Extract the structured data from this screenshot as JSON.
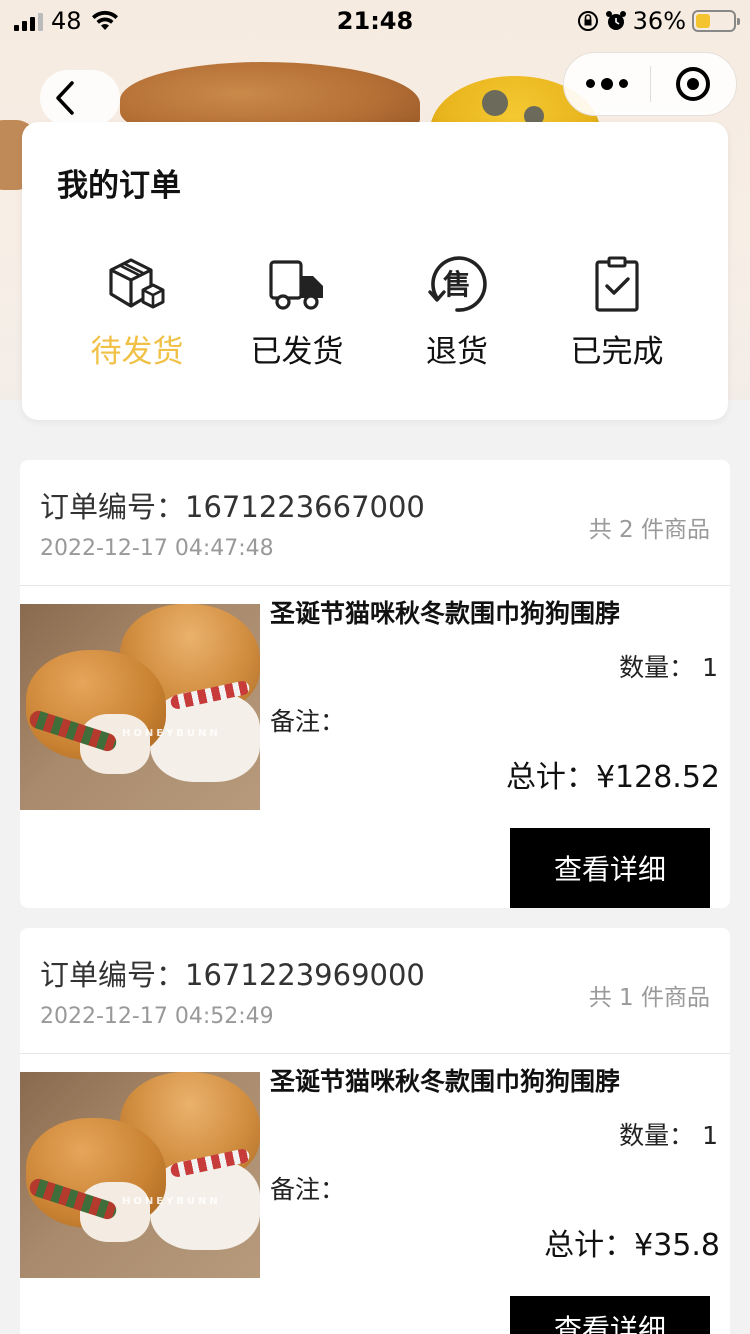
{
  "status_bar": {
    "signal_text": "48",
    "time": "21:48",
    "battery_text": "36%"
  },
  "my_orders": {
    "title": "我的订单",
    "tabs": [
      {
        "label": "待发货",
        "icon": "package-icon",
        "active": true
      },
      {
        "label": "已发货",
        "icon": "truck-icon",
        "active": false
      },
      {
        "label": "退货",
        "icon": "return-icon",
        "active": false
      },
      {
        "label": "已完成",
        "icon": "clipboard-check-icon",
        "active": false
      }
    ]
  },
  "orders": [
    {
      "number_label": "订单编号：",
      "number": "1671223667000",
      "date": "2022-12-17 04:47:48",
      "count_text": "共 2 件商品",
      "product_title": "圣诞节猫咪秋冬款围巾狗狗围脖",
      "qty_label": "数量：",
      "qty": "1",
      "note_label": "备注：",
      "total_label": "总计：",
      "total": "¥128.52",
      "detail_button": "查看详细",
      "image_watermark": "HONEYBUNN"
    },
    {
      "number_label": "订单编号：",
      "number": "1671223969000",
      "date": "2022-12-17 04:52:49",
      "count_text": "共 1 件商品",
      "product_title": "圣诞节猫咪秋冬款围巾狗狗围脖",
      "qty_label": "数量：",
      "qty": "1",
      "note_label": "备注：",
      "total_label": "总计：",
      "total": "¥35.8",
      "detail_button": "查看详细",
      "image_watermark": "HONEYBUNN"
    }
  ],
  "colors": {
    "accent_active": "#f0c146",
    "button_bg": "#000000",
    "page_bg": "#f2f2f2"
  }
}
